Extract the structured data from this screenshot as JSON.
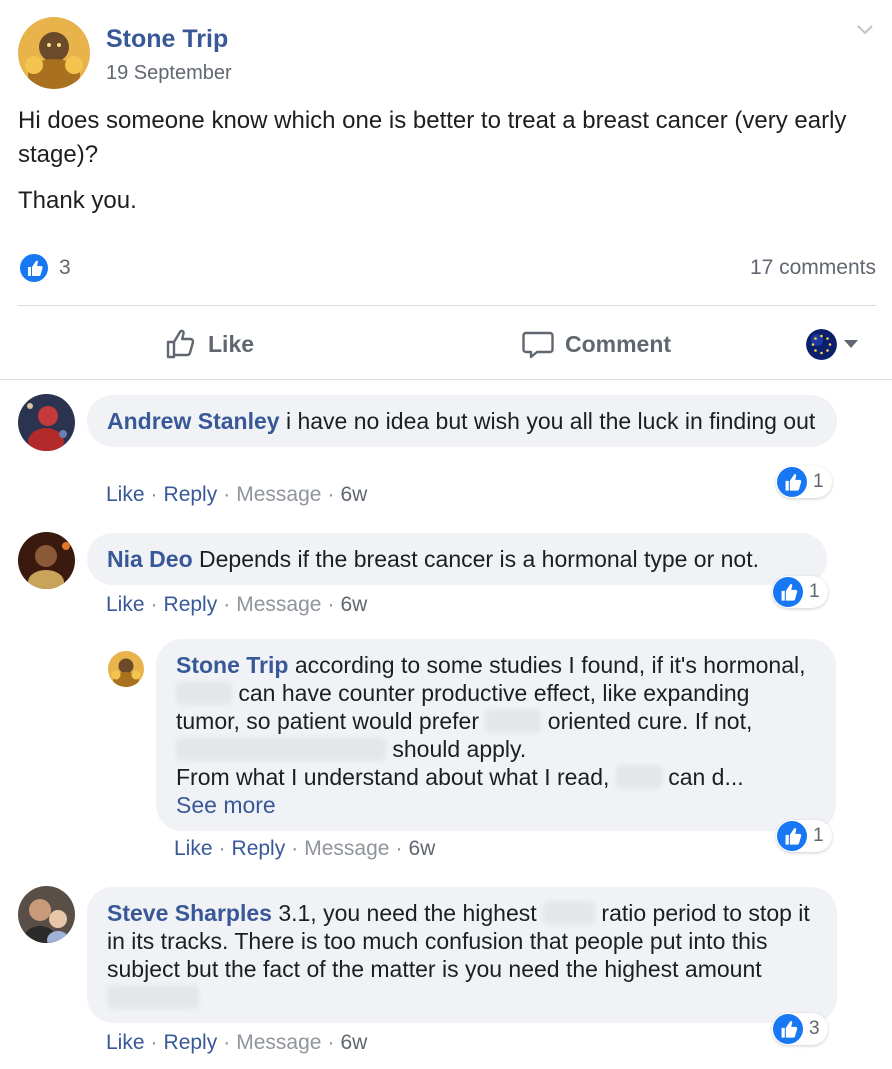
{
  "post": {
    "author": "Stone Trip",
    "date": "19 September",
    "text_line1": "Hi does someone know which one is better to treat a breast cancer (very early stage)?",
    "text_line2": "Thank you.",
    "like_count": "3",
    "comments_count": "17 comments"
  },
  "actions": {
    "like_label": "Like",
    "comment_label": "Comment"
  },
  "comments": [
    {
      "author": "Andrew Stanley",
      "text": "i have no idea but wish you all the luck in finding out",
      "likes": "1",
      "like_label": "Like",
      "reply_label": "Reply",
      "message_label": "Message",
      "age": "6w"
    },
    {
      "author": "Nia Deo",
      "text": "Depends if the breast cancer is a hormonal type or not.",
      "likes": "1",
      "like_label": "Like",
      "reply_label": "Reply",
      "message_label": "Message",
      "age": "6w"
    },
    {
      "author": "Stone Trip",
      "text_a": "according to some studies I found, if it's hormonal,",
      "text_b": "can have counter productive effect, like expanding tumor, so patient would prefer",
      "text_c": "oriented cure. If not,",
      "text_d": "should apply.",
      "text_e": "From what I understand about what I read,",
      "text_f": "can d...",
      "see_more": "See more",
      "likes": "1",
      "like_label": "Like",
      "reply_label": "Reply",
      "message_label": "Message",
      "age": "6w"
    },
    {
      "author": "Steve Sharples",
      "text_a": "3.1, you need the highest",
      "text_b": "ratio period to stop it in its tracks. There is too much confusion that people put into this subject but the fact of the matter is you need the highest amount",
      "likes": "3",
      "like_label": "Like",
      "reply_label": "Reply",
      "message_label": "Message",
      "age": "6w"
    }
  ],
  "colors": {
    "link": "#385898",
    "like_blue": "#1877f2",
    "bubble_bg": "#f0f2f5",
    "meta_gray": "#90949c"
  },
  "icons": [
    "chevron-down-icon",
    "thumbs-up-icon",
    "comment-icon",
    "globe-icon",
    "like-reaction-icon"
  ]
}
